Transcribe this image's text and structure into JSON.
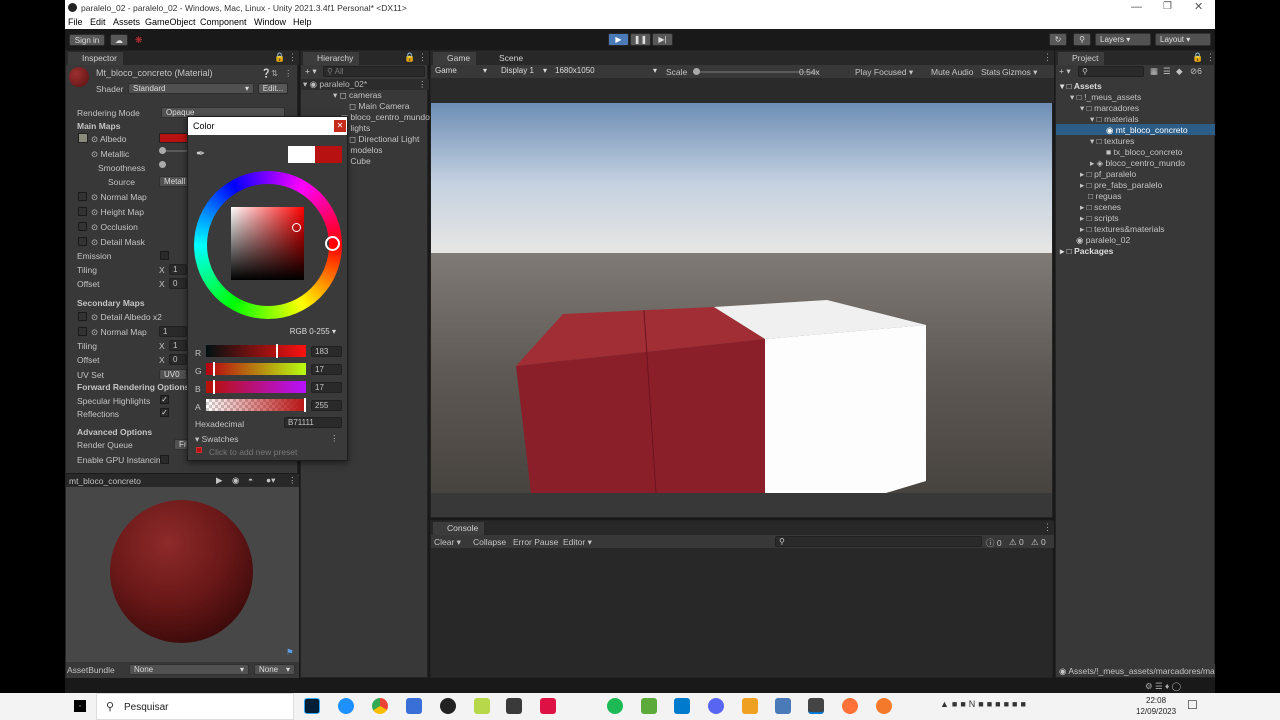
{
  "window": {
    "title": "paralelo_02 - paralelo_02 - Windows, Mac, Linux - Unity 2021.3.4f1 Personal* <DX11>"
  },
  "menu": [
    "File",
    "Edit",
    "Assets",
    "GameObject",
    "Component",
    "Window",
    "Help"
  ],
  "toolbar": {
    "signin": "Sign in",
    "layers": "Layers",
    "layout": "Layout"
  },
  "inspector": {
    "tab": "Inspector",
    "material_name": "Mt_bloco_concreto (Material)",
    "shader_label": "Shader",
    "shader_value": "Standard",
    "edit_label": "Edit...",
    "rendering_mode_label": "Rendering Mode",
    "rendering_mode_value": "Opaque",
    "main_maps": "Main Maps",
    "albedo": "Albedo",
    "metallic": "Metallic",
    "smoothness": "Smoothness",
    "source": "Source",
    "source_value": "Metall",
    "normal_map": "Normal Map",
    "height_map": "Height Map",
    "occlusion": "Occlusion",
    "detail_mask": "Detail Mask",
    "emission": "Emission",
    "tiling": "Tiling",
    "offset": "Offset",
    "x": "X",
    "tiling_x": "1",
    "offset_x": "0",
    "secondary_maps": "Secondary Maps",
    "detail_albedo": "Detail Albedo x2",
    "normal_map2": "Normal Map",
    "normal_map2_value": "1",
    "tiling2_x": "1",
    "offset2_x": "0",
    "uv_set": "UV Set",
    "uv_set_value": "UV0",
    "forward_options": "Forward Rendering Options",
    "specular_highlights": "Specular Highlights",
    "reflections": "Reflections",
    "advanced_options": "Advanced Options",
    "render_queue": "Render Queue",
    "render_queue_value": "Fro",
    "gpu_instancing": "Enable GPU Instancin",
    "preview_name": "mt_bloco_concreto",
    "assetbundle_label": "AssetBundle",
    "assetbundle_value": "None",
    "assetbundle_variant": "None",
    "albedo_color": "#B71111"
  },
  "color_picker": {
    "title": "Color",
    "mode": "RGB 0-255",
    "r_label": "R",
    "g_label": "G",
    "b_label": "B",
    "a_label": "A",
    "r": 183,
    "g": 17,
    "b": 17,
    "a": 255,
    "r_text": "183",
    "g_text": "17",
    "b_text": "17",
    "a_text": "255",
    "hex_label": "Hexadecimal",
    "hex_value": "B71111",
    "swatches_label": "Swatches",
    "swatches_hint": "Click to add new preset",
    "color": "#B71111"
  },
  "hierarchy": {
    "tab": "Hierarchy",
    "search_placeholder": "All",
    "items": [
      {
        "label": "paralelo_02*"
      },
      {
        "label": "cameras"
      },
      {
        "label": "Main Camera"
      },
      {
        "label": "bloco_centro_mundo"
      },
      {
        "label": "lights"
      },
      {
        "label": "Directional Light"
      },
      {
        "label": "modelos"
      },
      {
        "label": "Cube"
      }
    ]
  },
  "game": {
    "tab_game": "Game",
    "tab_scene": "Scene",
    "mode": "Game",
    "display": "Display 1",
    "resolution": "1680x1050",
    "scale_label": "Scale",
    "scale_value": "0.54x",
    "play_focused": "Play Focused",
    "mute_audio": "Mute Audio",
    "stats": "Stats",
    "gizmos": "Gizmos"
  },
  "console": {
    "tab": "Console",
    "clear": "Clear",
    "collapse": "Collapse",
    "error_pause": "Error Pause",
    "editor": "Editor",
    "count_info": "0",
    "count_warn": "0",
    "count_err": "0"
  },
  "project": {
    "tab": "Project",
    "badge": "6",
    "tree": [
      {
        "label": "Assets"
      },
      {
        "label": "!_meus_assets"
      },
      {
        "label": "marcadores"
      },
      {
        "label": "materials"
      },
      {
        "label": "mt_bloco_concreto"
      },
      {
        "label": "textures"
      },
      {
        "label": "tx_bloco_concreto"
      },
      {
        "label": "bloco_centro_mundo"
      },
      {
        "label": "pf_paralelo"
      },
      {
        "label": "pre_fabs_paralelo"
      },
      {
        "label": "reguas"
      },
      {
        "label": "scenes"
      },
      {
        "label": "scripts"
      },
      {
        "label": "textures&materials"
      },
      {
        "label": "paralelo_02"
      },
      {
        "label": "Packages"
      }
    ],
    "path": "Assets/!_meus_assets/marcadores/ma"
  },
  "taskbar": {
    "search": "Pesquisar",
    "time": "22:08",
    "date": "12/09/2023"
  }
}
